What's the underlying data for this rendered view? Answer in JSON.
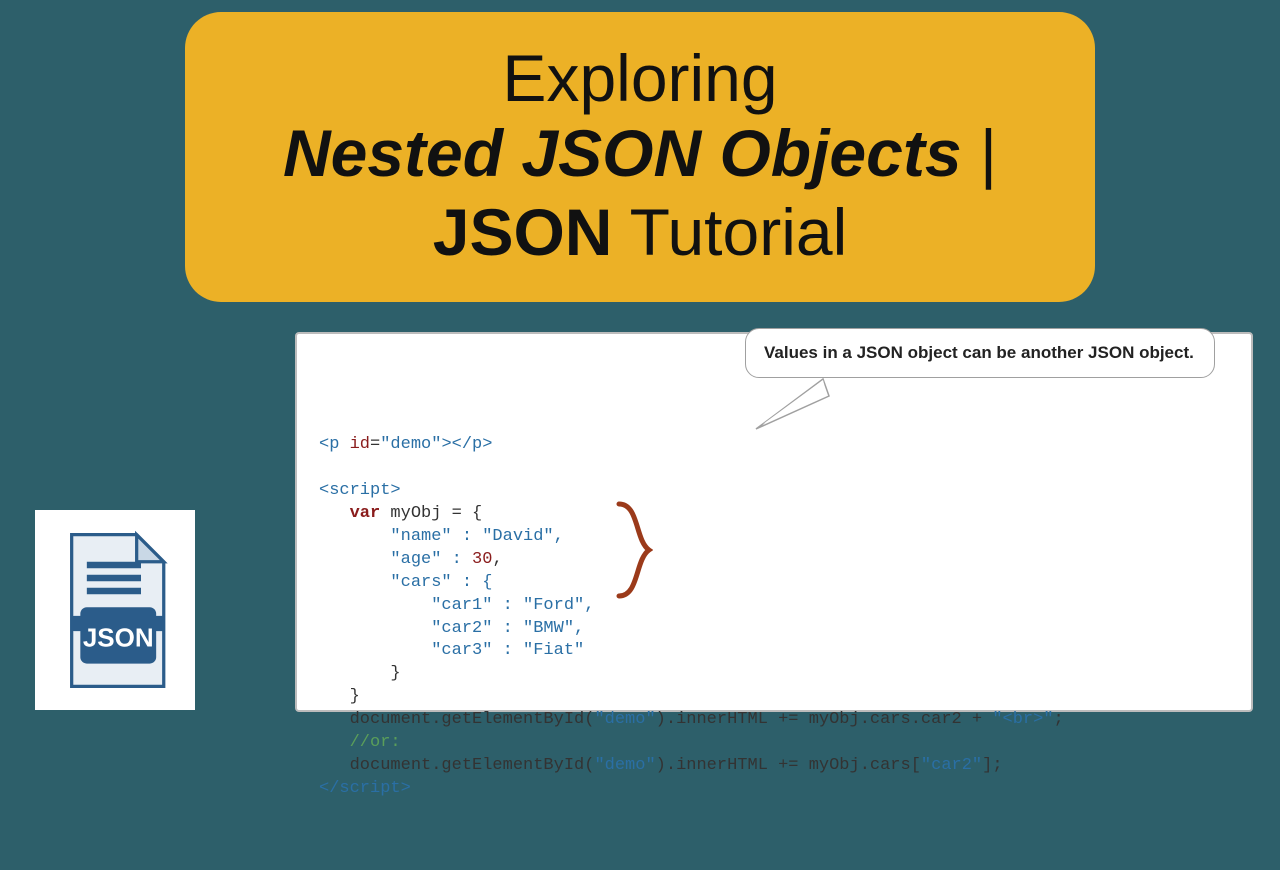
{
  "title": {
    "line1": "Exploring",
    "line2_em": "Nested JSON Objects",
    "line2_sep": " | ",
    "line3_bold": "JSON",
    "line3_rest": " Tutorial"
  },
  "bubble_text": "Values in a JSON object can be another JSON object.",
  "badge": {
    "label": "JSON"
  },
  "code": {
    "l01_open": "<p ",
    "l01_idattr": "id",
    "l01_eq": "=",
    "l01_idval": "\"demo\"",
    "l01_close": "></p>",
    "l02_blank": "",
    "l03_script_open": "<script>",
    "l04_indent": "   ",
    "l04_var": "var",
    "l04_rest": " myObj = {",
    "l05": "       \"name\" : \"David\",",
    "l06_a": "       \"age\" : ",
    "l06_num": "30",
    "l06_b": ",",
    "l07": "       \"cars\" : {",
    "l08": "           \"car1\" : \"Ford\",",
    "l09": "           \"car2\" : \"BMW\",",
    "l10": "           \"car3\" : \"Fiat\"",
    "l11": "       }",
    "l12": "   }",
    "l13_a": "   document.getElementById(",
    "l13_demo": "\"demo\"",
    "l13_b": ").innerHTML += myObj.cars.car2 + ",
    "l13_br": "\"<br>\"",
    "l13_c": ";",
    "l14_comment": "   //or:",
    "l15_a": "   document.getElementById(",
    "l15_demo": "\"demo\"",
    "l15_b": ").innerHTML += myObj.cars[",
    "l15_car2": "\"car2\"",
    "l15_c": "];",
    "l16_script_close": "</scr"
  },
  "script_close_tail": "ipt>"
}
